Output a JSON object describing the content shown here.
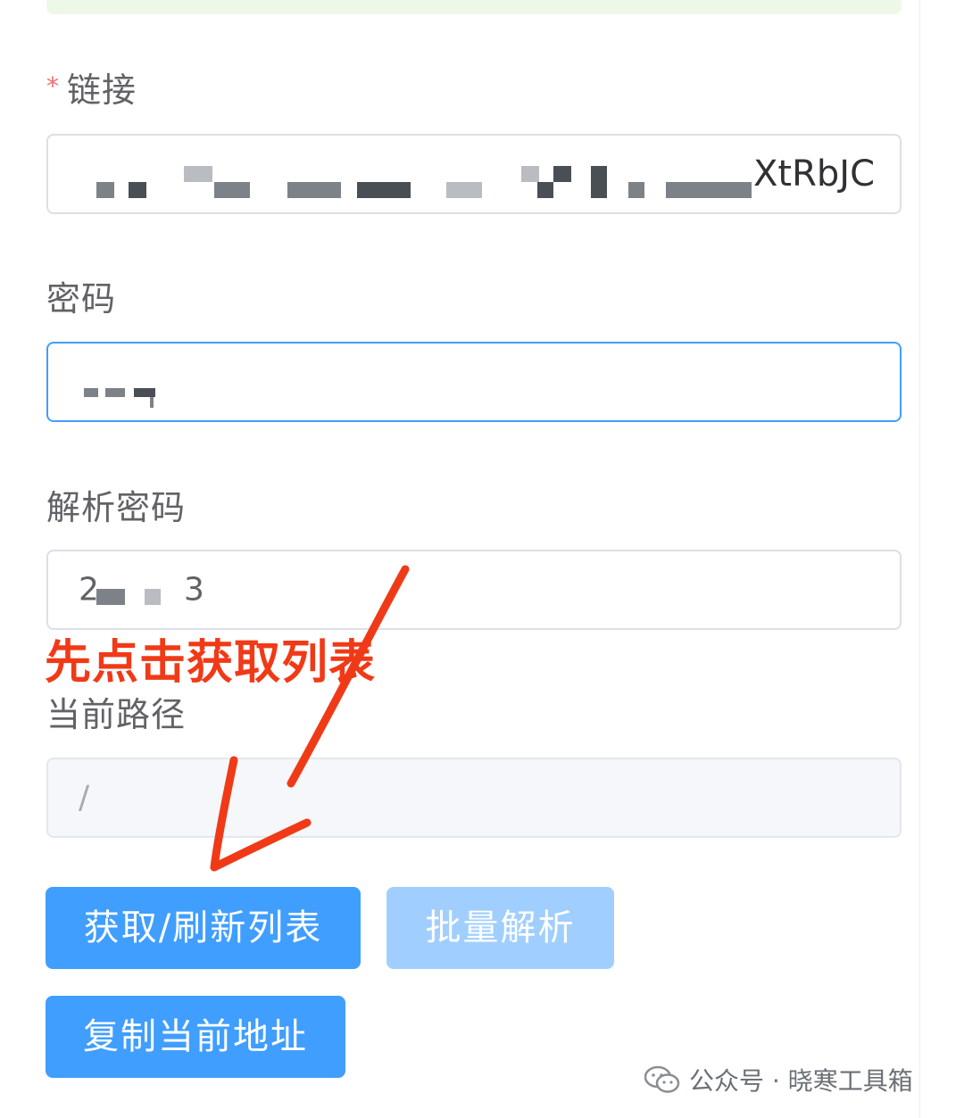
{
  "form": {
    "link": {
      "label": "链接",
      "required_mark": "*",
      "value_visible_tail": "XtRbJC"
    },
    "password": {
      "label": "密码"
    },
    "parse_password": {
      "label": "解析密码",
      "value_prefix": "2",
      "value_suffix": "3"
    },
    "current_path": {
      "label": "当前路径",
      "value": "/"
    }
  },
  "buttons": {
    "fetch_refresh_list": "获取/刷新列表",
    "batch_parse": "批量解析",
    "copy_current_address": "复制当前地址"
  },
  "annotation": {
    "text": "先点击获取列表",
    "color": "#f03a17"
  },
  "watermark": {
    "text": "公众号 · 晓寒工具箱"
  },
  "colors": {
    "primary": "#409eff",
    "primary_disabled": "#a0cfff",
    "required": "#f56c6c",
    "focus_border": "#409eff"
  }
}
